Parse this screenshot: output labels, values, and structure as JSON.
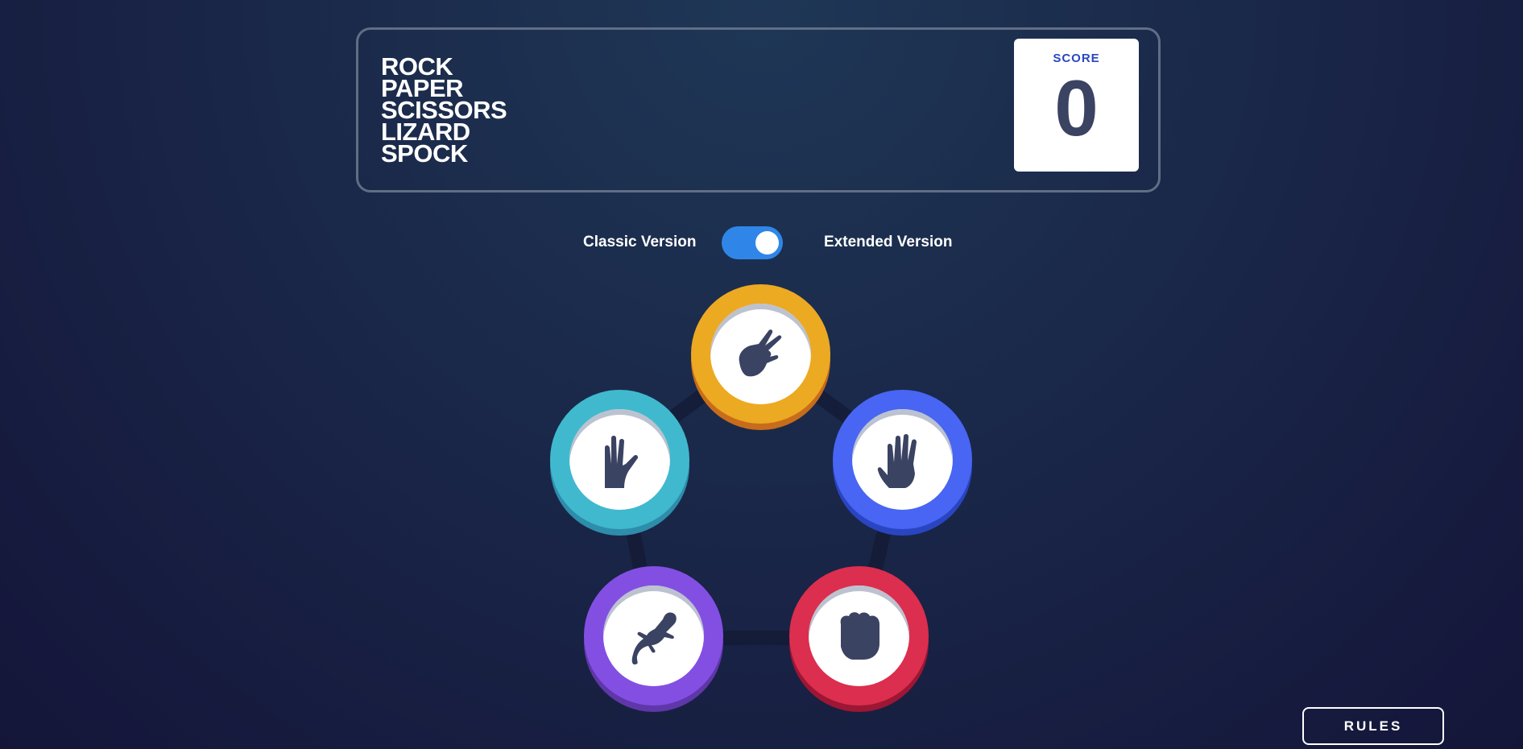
{
  "header": {
    "title_lines": [
      "ROCK",
      "PAPER",
      "SCISSORS",
      "LIZARD",
      "SPOCK"
    ],
    "score_label": "SCORE",
    "score_value": "0"
  },
  "version_toggle": {
    "left_label": "Classic Version",
    "right_label": "Extended Version",
    "selected": "Extended Version"
  },
  "choices": [
    {
      "name": "scissors",
      "icon": "scissors-hand-icon",
      "color": "#eca922",
      "shadow": "#c76c1b"
    },
    {
      "name": "paper",
      "icon": "paper-hand-icon",
      "color": "#4865f4",
      "shadow": "#2a45c2"
    },
    {
      "name": "rock",
      "icon": "rock-hand-icon",
      "color": "#dc2e4e",
      "shadow": "#9d1634"
    },
    {
      "name": "lizard",
      "icon": "lizard-icon",
      "color": "#834fe3",
      "shadow": "#5f37a8"
    },
    {
      "name": "spock",
      "icon": "spock-hand-icon",
      "color": "#40b9ce",
      "shadow": "#2d8dab"
    }
  ],
  "rules_button": {
    "label": "RULES"
  },
  "colors": {
    "background_top": "#1f3756",
    "background_bottom": "#141539",
    "toggle_on": "#2f86e8",
    "score_label": "#2a46c0",
    "dark_text": "#3b4363"
  }
}
